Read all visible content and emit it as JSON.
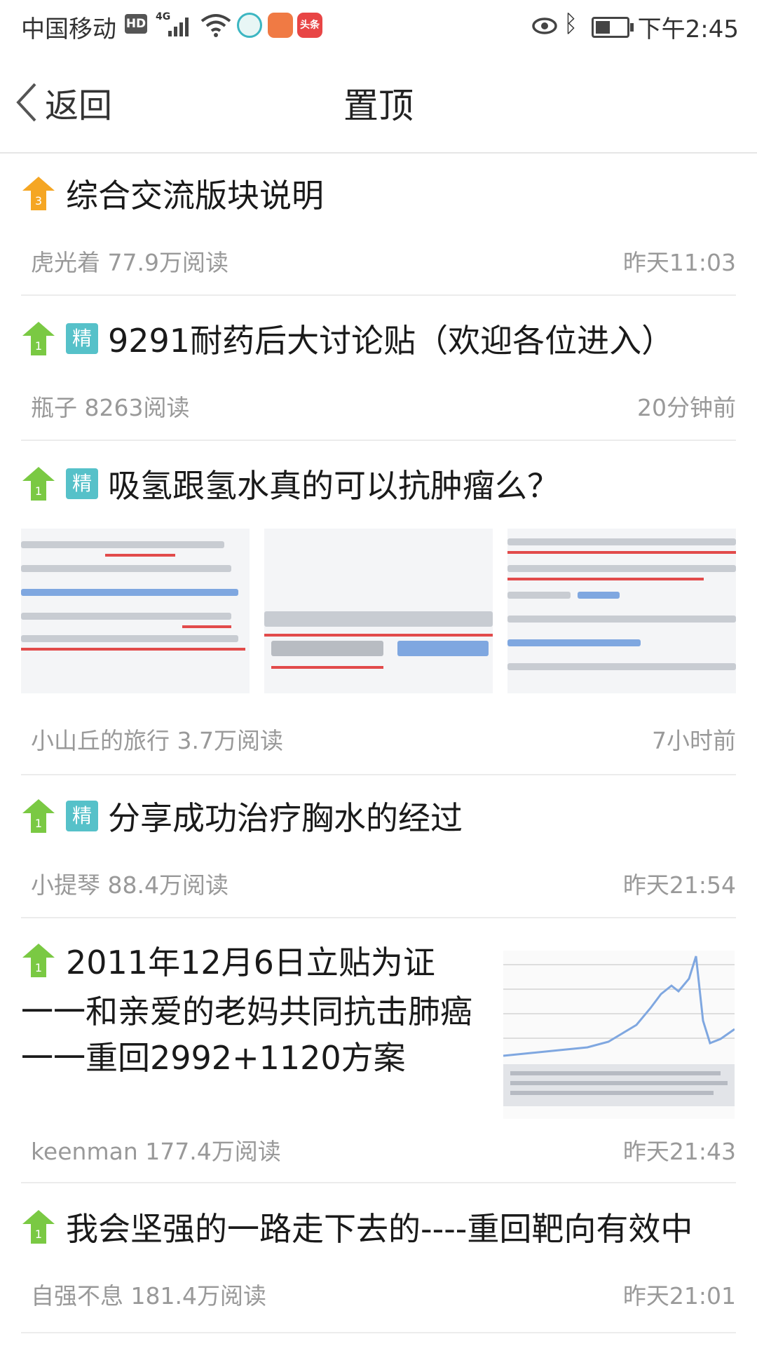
{
  "status_bar": {
    "carrier": "中国移动",
    "hd": "HD",
    "network": "4G",
    "app_badge": "头条",
    "time": "下午2:45",
    "icons": [
      "signal-icon",
      "wifi-icon",
      "eye-icon",
      "bluetooth-icon",
      "battery-icon"
    ]
  },
  "nav": {
    "back_label": "返回",
    "title": "置顶"
  },
  "colors": {
    "pin_orange": "#f5a623",
    "pin_green": "#7ac943",
    "essence_tag": "#56c1c9",
    "meta_text": "#999999"
  },
  "essence_label": "精",
  "posts": [
    {
      "rank": "3",
      "title": "综合交流版块说明",
      "author_reads": "虎光着 77.9万阅读",
      "time": "昨天11:03"
    },
    {
      "rank": "1",
      "title": "9291耐药后大讨论贴（欢迎各位进入）",
      "author_reads": "瓶子 8263阅读",
      "time": "20分钟前"
    },
    {
      "rank": "1",
      "title": "吸氢跟氢水真的可以抗肿瘤么？",
      "author_reads": "小山丘的旅行 3.7万阅读",
      "time": "7小时前"
    },
    {
      "rank": "1",
      "title": "分享成功治疗胸水的经过",
      "author_reads": "小提琴 88.4万阅读",
      "time": "昨天21:54"
    },
    {
      "rank": "1",
      "title_lines": [
        "2011年12月6日立贴为证",
        "一一和亲爱的老妈共同抗击肺癌",
        "一一重回2992+1120方案"
      ],
      "author_reads": "keenman 177.4万阅读",
      "time": "昨天21:43"
    },
    {
      "rank": "1",
      "title": "我会坚强的一路走下去的----重回靶向有效中",
      "author_reads": "自强不息 181.4万阅读",
      "time": "昨天21:01"
    }
  ]
}
